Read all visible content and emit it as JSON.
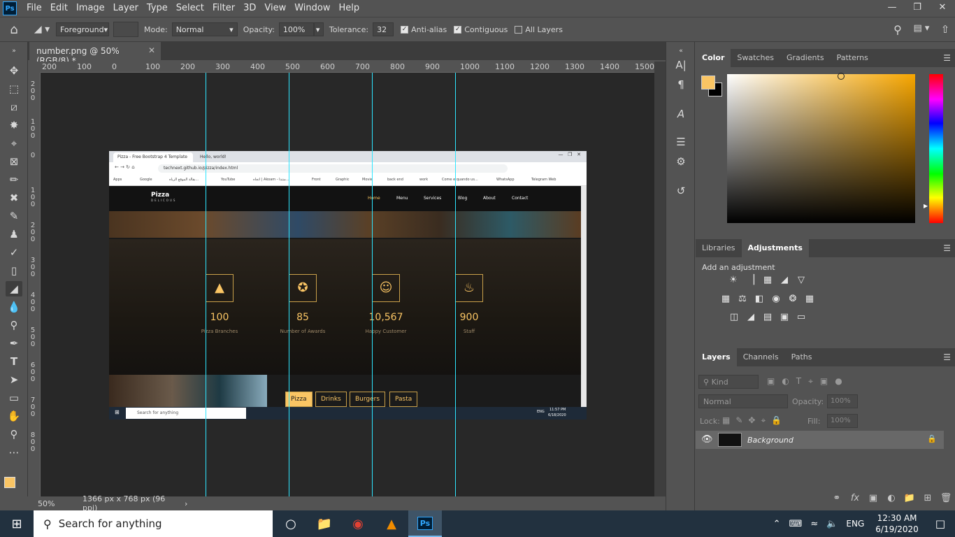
{
  "app": {
    "logo": "Ps",
    "menu": [
      "File",
      "Edit",
      "Image",
      "Layer",
      "Type",
      "Select",
      "Filter",
      "3D",
      "View",
      "Window",
      "Help"
    ]
  },
  "options": {
    "source": "Foreground",
    "mode_label": "Mode:",
    "mode_value": "Normal",
    "opacity_label": "Opacity:",
    "opacity_value": "100%",
    "tolerance_label": "Tolerance:",
    "tolerance_value": "32",
    "antialias_label": "Anti-alias",
    "contiguous_label": "Contiguous",
    "alllayers_label": "All Layers"
  },
  "document": {
    "tab_title": "number.png @ 50% (RGB/8) *",
    "zoom": "50%",
    "doc_info": "1366 px x 768 px (96 ppi)"
  },
  "rulers": {
    "h_labels": [
      "200",
      "100",
      "0",
      "100",
      "200",
      "300",
      "400",
      "500",
      "600",
      "700",
      "800",
      "900",
      "1000",
      "1100",
      "1200",
      "1300",
      "1400",
      "1500"
    ],
    "v_labels": [
      "200",
      "100",
      "0",
      "100",
      "200",
      "300",
      "400",
      "500",
      "600",
      "700",
      "800"
    ]
  },
  "screenshot": {
    "tabs": [
      "Pizza - Free Bootstrap 4 Template",
      "Hello, world!"
    ],
    "url": "technext.github.io/pizza/index.html",
    "bookmarks": [
      "Apps",
      "Google",
      "بقالة الموقع الرياه...",
      "YouTube",
      "اتجاه | Akoam - منتدا...",
      "Front",
      "Graphic",
      "Movie",
      "back end",
      "work",
      "Come e quando us...",
      "WhatsApp",
      "Telegram Web"
    ],
    "logo_title": "Pizza",
    "logo_sub": "DELICOUS",
    "nav": [
      "Home",
      "Menu",
      "Services",
      "Blog",
      "About",
      "Contact"
    ],
    "stats": [
      {
        "icon": "pizza-slice-icon",
        "value": "100",
        "label": "Pizza Branches"
      },
      {
        "icon": "award-icon",
        "value": "85",
        "label": "Number of Awards"
      },
      {
        "icon": "customer-icon",
        "value": "10,567",
        "label": "Happy Customer"
      },
      {
        "icon": "chef-hat-icon",
        "value": "900",
        "label": "Staff"
      }
    ],
    "menu_tabs": [
      "Pizza",
      "Drinks",
      "Burgers",
      "Pasta"
    ],
    "taskbar_search": "Search for anything",
    "time": "11:57 PM",
    "date": "6/18/2020",
    "lang": "ENG"
  },
  "panels": {
    "color_tabs": [
      "Color",
      "Swatches",
      "Gradients",
      "Patterns"
    ],
    "adj_tabs": [
      "Libraries",
      "Adjustments"
    ],
    "adj_title": "Add an adjustment",
    "layer_tabs": [
      "Layers",
      "Channels",
      "Paths"
    ],
    "layer_filter": "Kind",
    "blend_mode": "Normal",
    "opacity_label": "Opacity:",
    "opacity_value": "100%",
    "lock_label": "Lock:",
    "fill_label": "Fill:",
    "fill_value": "100%",
    "layer_name": "Background",
    "fg_color": "#fac564",
    "bg_color": "#000000"
  },
  "taskbar": {
    "search": "Search for anything",
    "lang": "ENG",
    "time": "12:30 AM",
    "date": "6/19/2020"
  }
}
